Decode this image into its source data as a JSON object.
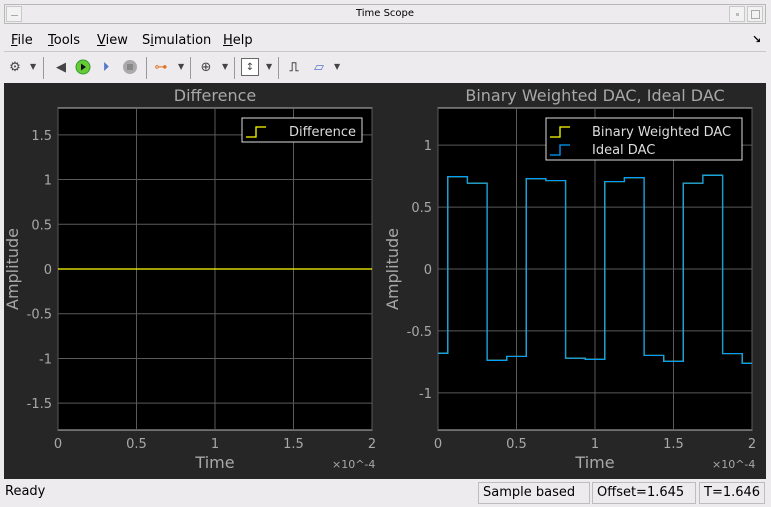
{
  "window": {
    "title": "Time Scope"
  },
  "menu": [
    "File",
    "Tools",
    "View",
    "Simulation",
    "Help"
  ],
  "menu_underline": [
    0,
    0,
    0,
    1,
    0
  ],
  "toolbar": {
    "icons": [
      "settings-icon",
      "restore-icon",
      "run-icon",
      "step-forward-icon",
      "stop-icon",
      "signal-selector-icon",
      "zoom-in-icon",
      "scale-axes-icon",
      "triggers-icon",
      "measurements-icon"
    ]
  },
  "status": {
    "ready": "Ready",
    "mode": "Sample based",
    "offset": "Offset=1.645",
    "time": "T=1.646"
  },
  "colors": {
    "yellow": "#ffff00",
    "blue": "#00a0ff",
    "grid": "#5a5a5a",
    "text": "#a8a8a8"
  },
  "chart_data": [
    {
      "type": "line",
      "title": "Difference",
      "xlabel": "Time",
      "ylabel": "Amplitude",
      "x_exponent": "×10^-4",
      "xlim": [
        0,
        2
      ],
      "ylim": [
        -1.8,
        1.8
      ],
      "xticks": [
        0,
        0.5,
        1,
        1.5,
        2
      ],
      "xtick_labels": [
        "0",
        "0.5",
        "1",
        "1.5",
        "2"
      ],
      "yticks": [
        -1.5,
        -1,
        -0.5,
        0,
        0.5,
        1,
        1.5
      ],
      "ytick_labels": [
        "-1.5",
        "-1",
        "-0.5",
        "0",
        "0.5",
        "1",
        "1.5"
      ],
      "grid": true,
      "legend": "top-right",
      "series": [
        {
          "name": "Difference",
          "color": "#ffff00",
          "step": true,
          "x": [
            0,
            2
          ],
          "y": [
            0,
            0
          ]
        }
      ]
    },
    {
      "type": "line",
      "title": "Binary Weighted DAC, Ideal DAC",
      "xlabel": "Time",
      "ylabel": "Amplitude",
      "x_exponent": "×10^-4",
      "xlim": [
        0,
        2
      ],
      "ylim": [
        -1.3,
        1.3
      ],
      "xticks": [
        0,
        0.5,
        1,
        1.5,
        2
      ],
      "xtick_labels": [
        "0",
        "0.5",
        "1",
        "1.5",
        "2"
      ],
      "yticks": [
        -1,
        -0.5,
        0,
        0.5,
        1
      ],
      "ytick_labels": [
        "-1",
        "-0.5",
        "0",
        "0.5",
        "1"
      ],
      "grid": true,
      "legend": "top-right",
      "series": [
        {
          "name": "Binary Weighted DAC",
          "color": "#ffff00",
          "step": true,
          "x": [
            0,
            0.0625,
            0.1875,
            0.3125,
            0.4375,
            0.5625,
            0.6875,
            0.8125,
            0.9375,
            1.0625,
            1.1875,
            1.3125,
            1.4375,
            1.5625,
            1.6875,
            1.8125,
            1.9375
          ],
          "y": [
            -0.68,
            0.746,
            0.693,
            -0.738,
            -0.706,
            0.73,
            0.714,
            -0.72,
            -0.73,
            0.706,
            0.738,
            -0.698,
            -0.746,
            0.693,
            0.757,
            -0.683,
            -0.762
          ]
        },
        {
          "name": "Ideal DAC",
          "color": "#00a0ff",
          "step": true,
          "x": [
            0,
            0.0625,
            0.1875,
            0.3125,
            0.4375,
            0.5625,
            0.6875,
            0.8125,
            0.9375,
            1.0625,
            1.1875,
            1.3125,
            1.4375,
            1.5625,
            1.6875,
            1.8125,
            1.9375
          ],
          "y": [
            -0.68,
            0.746,
            0.693,
            -0.738,
            -0.706,
            0.73,
            0.714,
            -0.72,
            -0.73,
            0.706,
            0.738,
            -0.698,
            -0.746,
            0.693,
            0.757,
            -0.683,
            -0.762
          ]
        }
      ]
    }
  ]
}
